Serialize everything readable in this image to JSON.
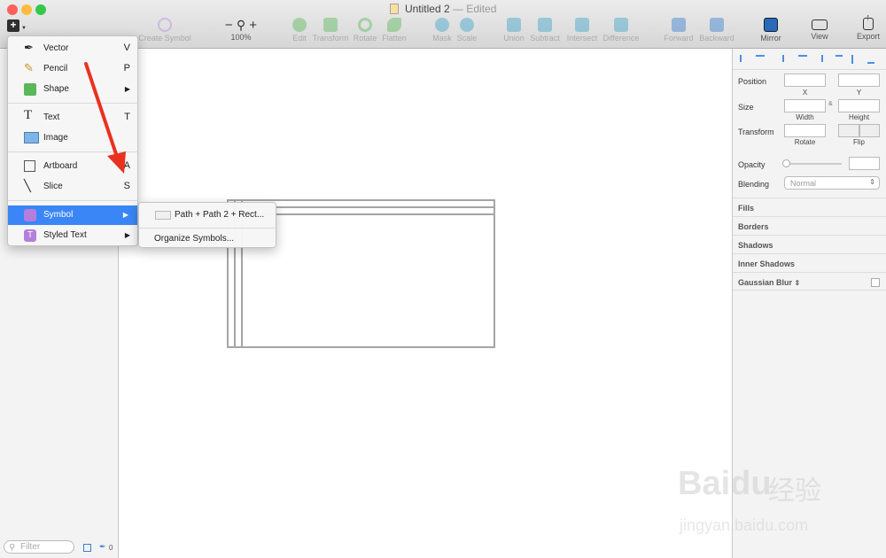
{
  "window": {
    "title": "Untitled 2",
    "status": "— Edited"
  },
  "toolbar": {
    "insert_icon": "plus-icon",
    "create_symbol": "Create Symbol",
    "zoom_minus": "−",
    "zoom_plus": "+",
    "zoom_level": "100%",
    "edit": "Edit",
    "transform": "Transform",
    "rotate": "Rotate",
    "flatten": "Flatten",
    "mask": "Mask",
    "scale": "Scale",
    "union": "Union",
    "subtract": "Subtract",
    "intersect": "Intersect",
    "difference": "Difference",
    "forward": "Forward",
    "backward": "Backward",
    "mirror": "Mirror",
    "view": "View",
    "export": "Export"
  },
  "insert_menu": {
    "items": [
      {
        "label": "Vector",
        "key": "V",
        "icon": "pen-icon"
      },
      {
        "label": "Pencil",
        "key": "P",
        "icon": "pencil-icon"
      },
      {
        "label": "Shape",
        "key": "▶",
        "icon": "shape-icon"
      },
      {
        "label": "Text",
        "key": "T",
        "icon": "text-icon"
      },
      {
        "label": "Image",
        "key": "",
        "icon": "image-icon"
      },
      {
        "label": "Artboard",
        "key": "A",
        "icon": "artboard-icon"
      },
      {
        "label": "Slice",
        "key": "S",
        "icon": "knife-icon"
      },
      {
        "label": "Symbol",
        "key": "▶",
        "icon": "symbol-icon"
      },
      {
        "label": "Styled Text",
        "key": "▶",
        "icon": "styled-text-icon"
      }
    ]
  },
  "symbol_submenu": {
    "symbol_item": "Path + Path 2 + Rect...",
    "organize": "Organize Symbols..."
  },
  "sidebar": {
    "filter_placeholder": "Filter",
    "slice_count": "0"
  },
  "inspector": {
    "position_label": "Position",
    "x_label": "X",
    "y_label": "Y",
    "size_label": "Size",
    "width_label": "Width",
    "height_label": "Height",
    "transform_label": "Transform",
    "rotate_label": "Rotate",
    "flip_label": "Flip",
    "opacity_label": "Opacity",
    "blending_label": "Blending",
    "blending_value": "Normal",
    "fills": "Fills",
    "borders": "Borders",
    "shadows": "Shadows",
    "inner_shadows": "Inner Shadows",
    "gaussian_blur": "Gaussian Blur"
  },
  "watermark": {
    "brand": "Baidu",
    "cn": "经验",
    "url": "jingyan.baidu.com"
  },
  "colors": {
    "accent": "#3b86f6",
    "arrow": "#e8321f",
    "close": "#fc605c",
    "minimize": "#fdbc40",
    "zoom": "#34c84a"
  }
}
